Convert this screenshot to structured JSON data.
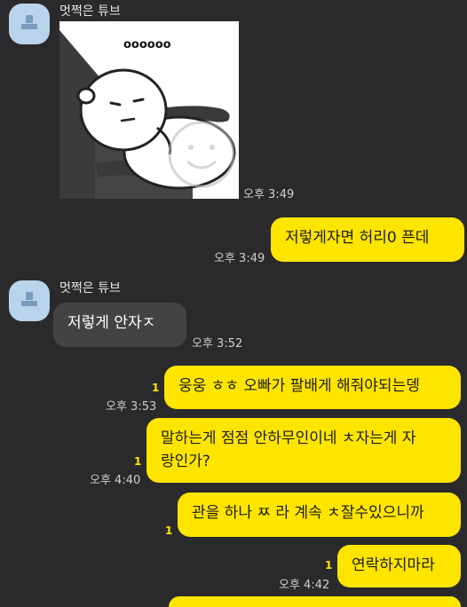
{
  "chat": {
    "sender_name": "멋쩍은 튜브",
    "sticker": {
      "dots_text": "oooooo"
    },
    "messages": [
      {
        "id": "m1",
        "from": "them",
        "type": "sticker",
        "time": "오후 3:49"
      },
      {
        "id": "m2",
        "from": "me",
        "text": "저렇게자면 허리0 픈데",
        "time": "오후 3:49",
        "unread": ""
      },
      {
        "id": "m3",
        "from": "them",
        "text": "저렇게 안자ㅈ",
        "time": "오후 3:52"
      },
      {
        "id": "m4",
        "from": "me",
        "text": "웅웅 ㅎㅎ 오빠가 팔배게 해줘야되는뎅",
        "time": "오후 3:53",
        "unread": "1"
      },
      {
        "id": "m5",
        "from": "me",
        "lines": [
          "말하는게 점점 안하무인이네 ㅊ자는게 자",
          "랑인가?"
        ],
        "time": "오후 4:40",
        "unread": "1"
      },
      {
        "id": "m6",
        "from": "me",
        "text": "관을 하나 ㅉ 라 계속 ㅊ잘수있으니까",
        "time": "",
        "unread": "1"
      },
      {
        "id": "m7",
        "from": "me",
        "text": "연락하지마라",
        "time": "오후 4:42",
        "unread": "1"
      }
    ]
  },
  "colors": {
    "background": "#2a2a2c",
    "incoming_bubble": "#434346",
    "outgoing_bubble": "#fee500",
    "avatar": "#b9d4ea"
  },
  "icons": {
    "avatar": "profile-avatar-icon"
  }
}
